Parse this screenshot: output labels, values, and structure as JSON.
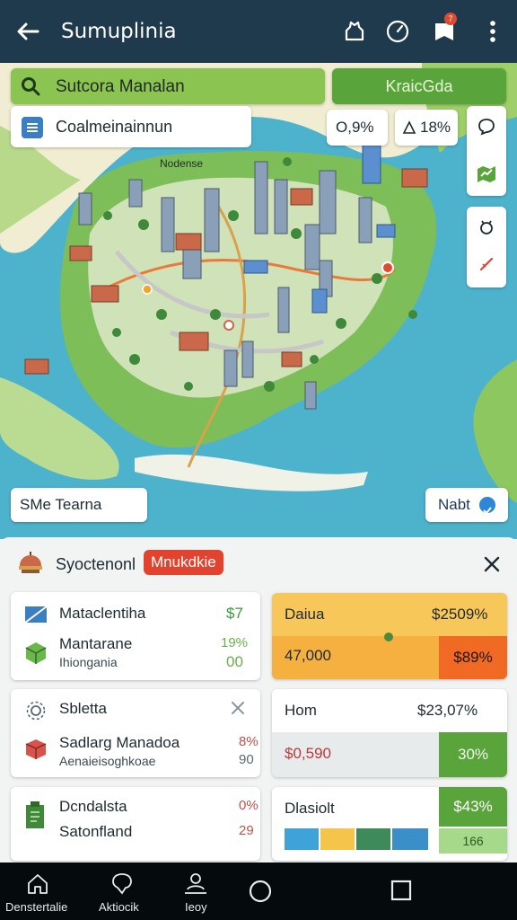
{
  "app": {
    "title": "Sumuplinia",
    "notification_count": "7"
  },
  "map": {
    "search_text": "Sutcora Manalan",
    "top_right_button": "KraicGda",
    "layer_label": "Coalmeinainnun",
    "chip_1": "O,9%",
    "chip_2": "18%",
    "map_label": "Nodense",
    "bottom_left_pill": "SMe Tearna",
    "bottom_right_pill": "Nabt"
  },
  "sheet": {
    "title": "Syoctenonl",
    "badge": "Mnukdkie",
    "cards_left": [
      {
        "row1_label": "Mataclentiha",
        "row1_value": "$7",
        "row2_label": "Mantarane",
        "row2_sub": "Ihiongania",
        "row2_value_a": "19%",
        "row2_value_b": "00"
      },
      {
        "row1_label": "Sbletta",
        "row2_label": "Sadlarg Manadoa",
        "row2_sub": "Aenaieisoghkoae",
        "row2_value_a": "8%",
        "row2_value_b": "90"
      },
      {
        "row1_label": "Dcndalsta",
        "row1_value": "0%",
        "row2_label": "Satonfland",
        "row2_value": "29"
      }
    ],
    "cards_right": [
      {
        "label": "Daiua",
        "top_value": "$2509%",
        "bottom_value": "47,000",
        "bottom_badge": "$89%"
      },
      {
        "label": "Hom",
        "top_value": "$23,07%",
        "bottom_value": "$0,590",
        "bottom_badge": "30%"
      },
      {
        "label": "Dlasiolt",
        "badge_top": "$43%",
        "badge_bottom": "166"
      }
    ]
  },
  "nav": {
    "items": [
      "Denstertalie",
      "Aktiocik",
      "Ieoy"
    ]
  },
  "colors": {
    "top_bar": "#1f3a4d",
    "accent_green": "#5aa43c",
    "search_green": "#8cc452",
    "badge_red": "#e2432f",
    "sea": "#4fb8cf"
  }
}
